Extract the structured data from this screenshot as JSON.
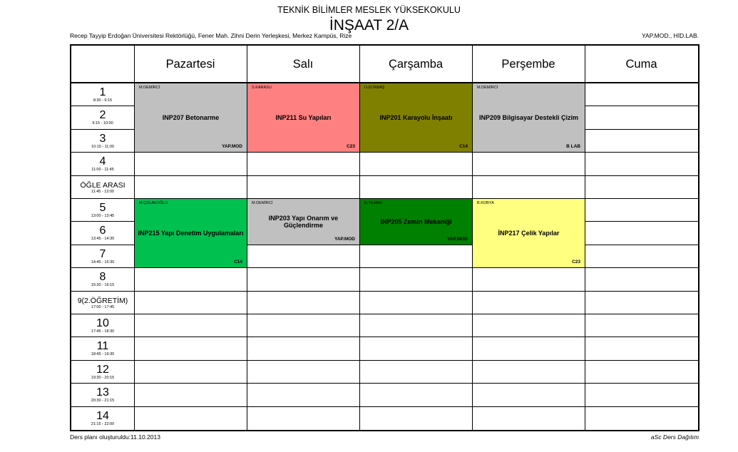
{
  "header": {
    "school": "TEKNİK BİLİMLER MESLEK YÜKSEKOKULU",
    "class_name": "İNŞAAT 2/A",
    "address": "Recep Tayyip Erdoğan Üniversitesi Rektörlüğü, Fener Mah. Zihni Derin Yerleşkesi, Merkez Kampüs, Rize",
    "rooms": "YAP.MOD., HİD.LAB."
  },
  "days": [
    "Pazartesi",
    "Salı",
    "Çarşamba",
    "Perşembe",
    "Cuma"
  ],
  "periods": [
    {
      "label": "1",
      "time": "8:30 - 9:15"
    },
    {
      "label": "2",
      "time": "9:15 - 10:00"
    },
    {
      "label": "3",
      "time": "10:15 - 11:00"
    },
    {
      "label": "4",
      "time": "11:00 - 11:45"
    },
    {
      "label": "ÖĞLE ARASI",
      "time": "11:45 - 13:00"
    },
    {
      "label": "5",
      "time": "13:00 - 13:45"
    },
    {
      "label": "6",
      "time": "13:45 - 14:30"
    },
    {
      "label": "7",
      "time": "14:45 - 15:30"
    },
    {
      "label": "8",
      "time": "15:30 - 16:15"
    },
    {
      "label": "9(2.ÖĞRETİM)",
      "time": "17:00 - 17:45"
    },
    {
      "label": "10",
      "time": "17:45 - 18:30"
    },
    {
      "label": "11",
      "time": "18:45 - 19:30"
    },
    {
      "label": "12",
      "time": "19:30 - 20:15"
    },
    {
      "label": "13",
      "time": "20:30 - 21:15"
    },
    {
      "label": "14",
      "time": "21:15 - 22:00"
    }
  ],
  "lessons": [
    {
      "day": 0,
      "start": 0,
      "span": 3,
      "teacher": "M.DEMİRCİ",
      "name": "INP207 Betonarme",
      "room": "YAP.MOD",
      "color": "#c0c0c0"
    },
    {
      "day": 1,
      "start": 0,
      "span": 3,
      "teacher": "S.KARASU",
      "name": "INP211 Su Yapıları",
      "room": "C23",
      "color": "#ff8080"
    },
    {
      "day": 2,
      "start": 0,
      "span": 3,
      "teacher": "İ.USTABAŞ",
      "name": "INP201 Karayolu İnşaatı",
      "room": "C14",
      "color": "#808000"
    },
    {
      "day": 3,
      "start": 0,
      "span": 3,
      "teacher": "M.DEMİRCİ",
      "name": "INP209 Bilgisayar Destekli Çizim",
      "room": "B LAB",
      "color": "#c0c0c0"
    },
    {
      "day": 0,
      "start": 5,
      "span": 3,
      "teacher": "M.ÇOLAKOĞLU",
      "name": "INP215 Yapı Denetim Uygulamaları",
      "room": "C14",
      "color": "#00c050"
    },
    {
      "day": 1,
      "start": 5,
      "span": 2,
      "teacher": "M.DEMİRCİ",
      "name": "INP203 Yapı Onarım ve Güçlendirme",
      "room": "YAP.MOD",
      "color": "#c0c0c0"
    },
    {
      "day": 2,
      "start": 5,
      "span": 2,
      "teacher": "D.YILMAZ",
      "name": "INP205 Zemin Mekaniği",
      "room": "YAP.MOD",
      "color": "#008000"
    },
    {
      "day": 3,
      "start": 5,
      "span": 3,
      "teacher": "B.KOBYA",
      "name": "İNP217 Çelik Yapılar",
      "room": "C23",
      "color": "#ffff80"
    }
  ],
  "footer": {
    "created": "Ders planı oluşturuldu:11.10.2013",
    "software": "aSc Ders Dağıtım"
  }
}
